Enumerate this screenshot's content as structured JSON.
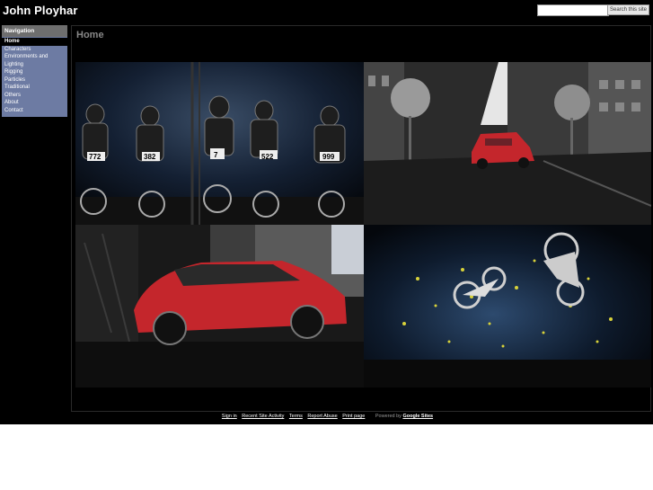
{
  "header": {
    "site_title": "John Ployhar",
    "search_placeholder": "",
    "search_button": "Search this site"
  },
  "nav": {
    "header": "Navigation",
    "items": [
      {
        "label": "Home",
        "active": true
      },
      {
        "label": "Characters"
      },
      {
        "label": "Environments and Lighting"
      },
      {
        "label": "Rigging"
      },
      {
        "label": "Particles"
      },
      {
        "label": "Traditional"
      },
      {
        "label": "Others"
      },
      {
        "label": "About"
      },
      {
        "label": "Contact"
      }
    ]
  },
  "main": {
    "title": "Home"
  },
  "gallery": {
    "plates": [
      "772",
      "382",
      "7",
      "522",
      "999"
    ]
  },
  "footer": {
    "links": [
      "Sign in",
      "Recent Site Activity",
      "Terms",
      "Report Abuse",
      "Print page"
    ],
    "powered_prefix": "Powered by",
    "powered_brand": "Google Sites"
  },
  "colors": {
    "background": "#000000",
    "nav_bg": "#6d7ba3",
    "nav_header_bg": "#6e6e6e",
    "car_red": "#c4262c"
  }
}
